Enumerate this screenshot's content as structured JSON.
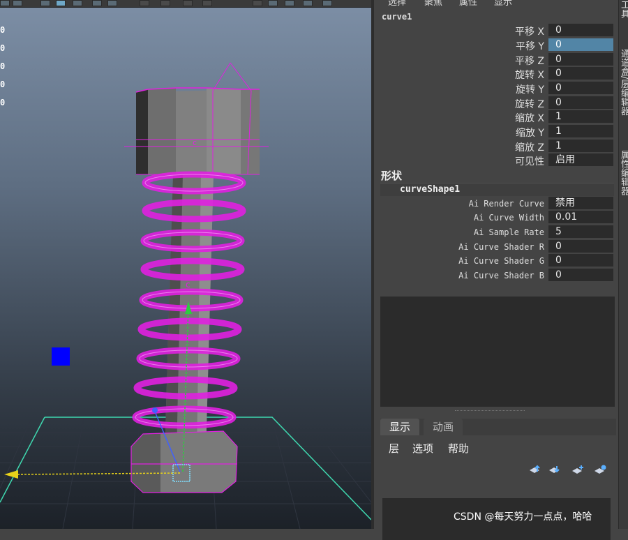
{
  "viewport": {
    "hud_values": [
      "0",
      "0",
      "0",
      "0",
      "0"
    ],
    "colors": {
      "wireframe": "#e020e0",
      "grid": "#2f3540",
      "grid_border": "#3fd9b0",
      "manipulator": "#0000ff"
    }
  },
  "panel": {
    "menu": [
      "选择",
      "聚焦",
      "属性",
      "显示"
    ],
    "side_tabs": [
      "工具",
      "通道盒/层编辑器",
      "属性编辑器"
    ],
    "node_name": "curve1",
    "transform_attrs": [
      {
        "label": "平移 X",
        "value": "0"
      },
      {
        "label": "平移 Y",
        "value": "0"
      },
      {
        "label": "平移 Z",
        "value": "0"
      },
      {
        "label": "旋转 X",
        "value": "0"
      },
      {
        "label": "旋转 Y",
        "value": "0"
      },
      {
        "label": "旋转 Z",
        "value": "0"
      },
      {
        "label": "缩放 X",
        "value": "1"
      },
      {
        "label": "缩放 Y",
        "value": "1"
      },
      {
        "label": "缩放 Z",
        "value": "1"
      },
      {
        "label": "可见性",
        "value": "启用"
      }
    ],
    "shapes_label": "形状",
    "shape_name": "curveShape1",
    "shape_attrs": [
      {
        "label": "Ai Render Curve",
        "value": "禁用"
      },
      {
        "label": "Ai Curve Width",
        "value": "0.01"
      },
      {
        "label": "Ai Sample Rate",
        "value": "5"
      },
      {
        "label": "Ai Curve Shader R",
        "value": "0"
      },
      {
        "label": "Ai Curve Shader G",
        "value": "0"
      },
      {
        "label": "Ai Curve Shader B",
        "value": "0"
      }
    ],
    "layer_editor": {
      "tabs": [
        "显示",
        "动画"
      ],
      "menu": [
        "层",
        "选项",
        "帮助"
      ],
      "buttons": [
        "move-layer-up-icon",
        "move-layer-down-icon",
        "new-layer-icon",
        "new-layer-from-selection-icon"
      ]
    }
  },
  "watermark": "CSDN @每天努力一点点，哈哈"
}
